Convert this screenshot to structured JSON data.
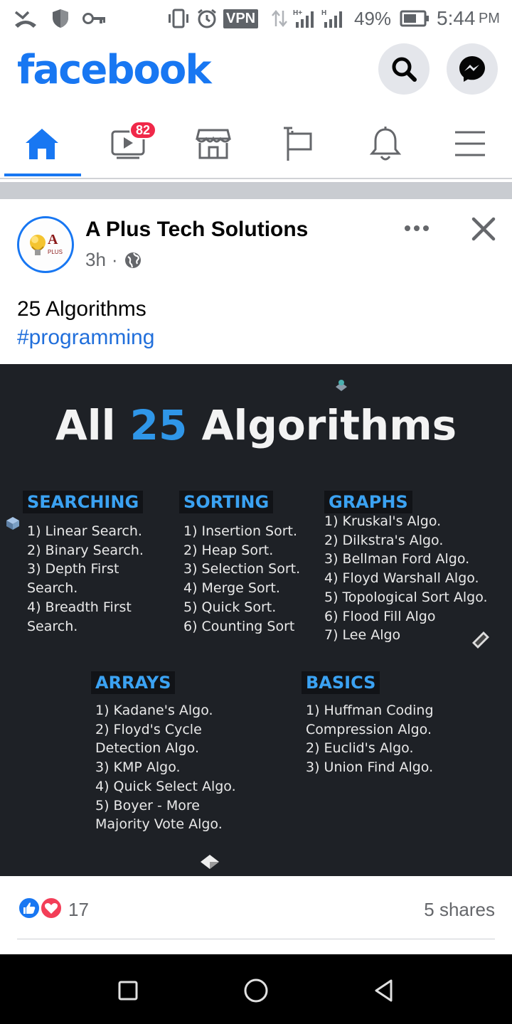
{
  "status_bar": {
    "vpn": "VPN",
    "battery": "49%",
    "time": "5:44",
    "ampm": "PM"
  },
  "header": {
    "logo": "facebook"
  },
  "tabs": [
    {
      "name": "home",
      "icon": "home-icon",
      "active": true
    },
    {
      "name": "watch",
      "icon": "video-icon",
      "badge": "82"
    },
    {
      "name": "marketplace",
      "icon": "store-icon"
    },
    {
      "name": "pages",
      "icon": "flag-icon"
    },
    {
      "name": "notifications",
      "icon": "bell-icon"
    },
    {
      "name": "menu",
      "icon": "hamburger-icon"
    }
  ],
  "post": {
    "page_name": "A Plus Tech Solutions",
    "time": "3h",
    "separator": "·",
    "text": "25 Algorithms",
    "hashtag": "#programming",
    "image": {
      "title_pre": "All",
      "title_num": "25",
      "title_post": "Algorithms",
      "sections": [
        {
          "heading": "SEARCHING",
          "items": "1) Linear Search.\n2) Binary Search.\n3) Depth First\nSearch.\n4) Breadth First\nSearch."
        },
        {
          "heading": "SORTING",
          "items": "1) Insertion Sort.\n2) Heap Sort.\n3) Selection Sort.\n4) Merge Sort.\n5) Quick Sort.\n6) Counting Sort"
        },
        {
          "heading": "GRAPHS",
          "items": "1) Kruskal's Algo.\n2) Dilkstra's Algo.\n3) Bellman Ford Algo.\n4) Floyd Warshall Algo.\n5) Topological Sort Algo.\n6) Flood Fill Algo\n7) Lee Algo"
        },
        {
          "heading": "ARRAYS",
          "items": "1) Kadane's Algo.\n2) Floyd's Cycle\nDetection Algo.\n3) KMP Algo.\n4) Quick Select Algo.\n5) Boyer - More\nMajority Vote Algo."
        },
        {
          "heading": "BASICS",
          "items": "1) Huffman Coding\nCompression Algo.\n2) Euclid's Algo.\n3) Union Find Algo."
        }
      ]
    },
    "reaction_count": "17",
    "shares": "5 shares"
  },
  "colors": {
    "brand": "#1877f2",
    "badge": "#f02849",
    "image_bg": "#1e2126",
    "heading_blue": "#3ba2f2"
  }
}
